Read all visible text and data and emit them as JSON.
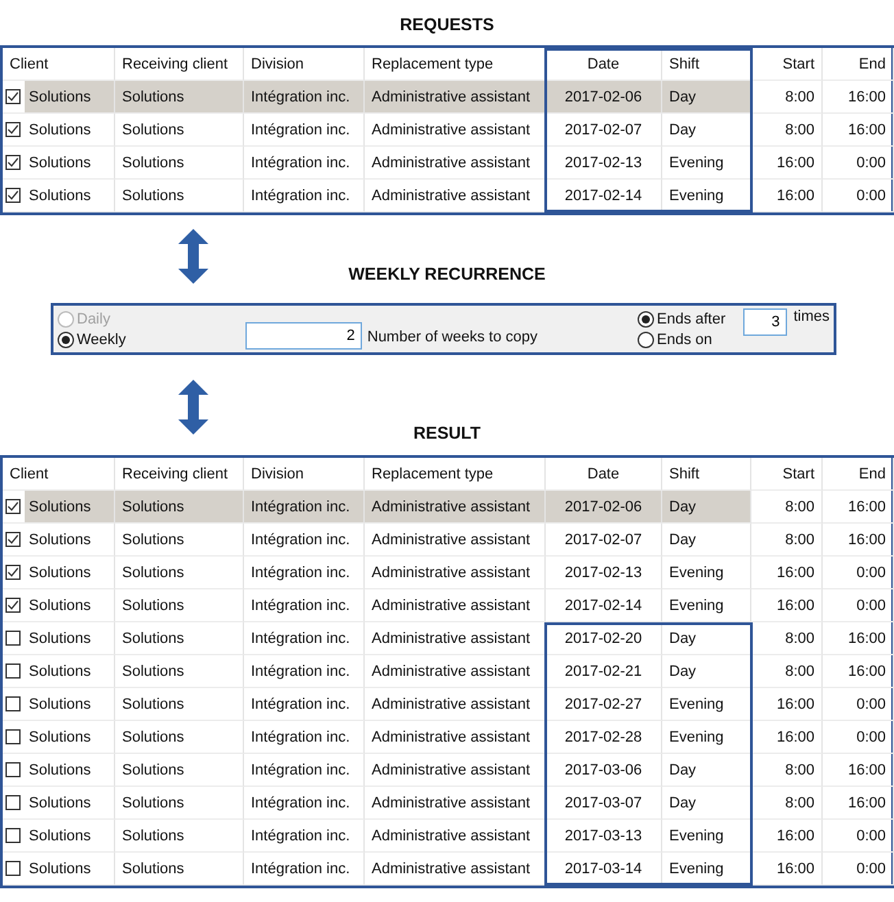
{
  "requests": {
    "title": "REQUESTS",
    "header_framed": true,
    "columns": [
      "Client",
      "Receiving client",
      "Division",
      "Replacement type",
      "Date",
      "Shift",
      "Start",
      "End"
    ],
    "rows": [
      {
        "checked": true,
        "selected": true,
        "framed": true,
        "cells": [
          "Solutions",
          "Solutions",
          "Intégration inc.",
          "Administrative assistant",
          "2017-02-06",
          "Day",
          "8:00",
          "16:00"
        ]
      },
      {
        "checked": true,
        "selected": false,
        "framed": true,
        "cells": [
          "Solutions",
          "Solutions",
          "Intégration inc.",
          "Administrative assistant",
          "2017-02-07",
          "Day",
          "8:00",
          "16:00"
        ]
      },
      {
        "checked": true,
        "selected": false,
        "framed": true,
        "cells": [
          "Solutions",
          "Solutions",
          "Intégration inc.",
          "Administrative assistant",
          "2017-02-13",
          "Evening",
          "16:00",
          "0:00"
        ]
      },
      {
        "checked": true,
        "selected": false,
        "framed": true,
        "cells": [
          "Solutions",
          "Solutions",
          "Intégration inc.",
          "Administrative assistant",
          "2017-02-14",
          "Evening",
          "16:00",
          "0:00"
        ]
      }
    ]
  },
  "recurrence": {
    "title": "WEEKLY RECURRENCE",
    "frequency": [
      {
        "label": "Daily",
        "selected": false,
        "disabled": true
      },
      {
        "label": "Weekly",
        "selected": true,
        "disabled": false
      }
    ],
    "weeks_value": "2",
    "weeks_label": "Number of weeks to copy",
    "end_options": [
      {
        "label": "Ends after",
        "selected": true
      },
      {
        "label": "Ends on",
        "selected": false
      }
    ],
    "times_value": "3",
    "times_label": "times"
  },
  "result": {
    "title": "RESULT",
    "header_framed": false,
    "columns": [
      "Client",
      "Receiving client",
      "Division",
      "Replacement type",
      "Date",
      "Shift",
      "Start",
      "End"
    ],
    "rows": [
      {
        "checked": true,
        "selected": true,
        "framed": false,
        "cells": [
          "Solutions",
          "Solutions",
          "Intégration inc.",
          "Administrative assistant",
          "2017-02-06",
          "Day",
          "8:00",
          "16:00"
        ]
      },
      {
        "checked": true,
        "selected": false,
        "framed": false,
        "cells": [
          "Solutions",
          "Solutions",
          "Intégration inc.",
          "Administrative assistant",
          "2017-02-07",
          "Day",
          "8:00",
          "16:00"
        ]
      },
      {
        "checked": true,
        "selected": false,
        "framed": false,
        "cells": [
          "Solutions",
          "Solutions",
          "Intégration inc.",
          "Administrative assistant",
          "2017-02-13",
          "Evening",
          "16:00",
          "0:00"
        ]
      },
      {
        "checked": true,
        "selected": false,
        "framed": false,
        "cells": [
          "Solutions",
          "Solutions",
          "Intégration inc.",
          "Administrative assistant",
          "2017-02-14",
          "Evening",
          "16:00",
          "0:00"
        ]
      },
      {
        "checked": false,
        "selected": false,
        "framed": true,
        "cells": [
          "Solutions",
          "Solutions",
          "Intégration inc.",
          "Administrative assistant",
          "2017-02-20",
          "Day",
          "8:00",
          "16:00"
        ]
      },
      {
        "checked": false,
        "selected": false,
        "framed": true,
        "cells": [
          "Solutions",
          "Solutions",
          "Intégration inc.",
          "Administrative assistant",
          "2017-02-21",
          "Day",
          "8:00",
          "16:00"
        ]
      },
      {
        "checked": false,
        "selected": false,
        "framed": true,
        "cells": [
          "Solutions",
          "Solutions",
          "Intégration inc.",
          "Administrative assistant",
          "2017-02-27",
          "Evening",
          "16:00",
          "0:00"
        ]
      },
      {
        "checked": false,
        "selected": false,
        "framed": true,
        "cells": [
          "Solutions",
          "Solutions",
          "Intégration inc.",
          "Administrative assistant",
          "2017-02-28",
          "Evening",
          "16:00",
          "0:00"
        ]
      },
      {
        "checked": false,
        "selected": false,
        "framed": true,
        "cells": [
          "Solutions",
          "Solutions",
          "Intégration inc.",
          "Administrative assistant",
          "2017-03-06",
          "Day",
          "8:00",
          "16:00"
        ]
      },
      {
        "checked": false,
        "selected": false,
        "framed": true,
        "cells": [
          "Solutions",
          "Solutions",
          "Intégration inc.",
          "Administrative assistant",
          "2017-03-07",
          "Day",
          "8:00",
          "16:00"
        ]
      },
      {
        "checked": false,
        "selected": false,
        "framed": true,
        "cells": [
          "Solutions",
          "Solutions",
          "Intégration inc.",
          "Administrative assistant",
          "2017-03-13",
          "Evening",
          "16:00",
          "0:00"
        ]
      },
      {
        "checked": false,
        "selected": false,
        "framed": true,
        "cells": [
          "Solutions",
          "Solutions",
          "Intégration inc.",
          "Administrative assistant",
          "2017-03-14",
          "Evening",
          "16:00",
          "0:00"
        ]
      }
    ]
  }
}
